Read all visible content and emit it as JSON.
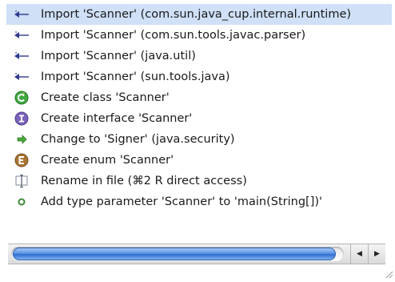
{
  "proposals": [
    {
      "label": "Import 'Scanner' (com.sun.java_cup.internal.runtime)",
      "icon": "import-arrow-icon",
      "selected": true
    },
    {
      "label": "Import 'Scanner' (com.sun.tools.javac.parser)",
      "icon": "import-arrow-icon"
    },
    {
      "label": "Import 'Scanner' (java.util)",
      "icon": "import-arrow-icon"
    },
    {
      "label": "Import 'Scanner' (sun.tools.java)",
      "icon": "import-arrow-icon"
    },
    {
      "label": "Create class 'Scanner'",
      "icon": "new-class-icon"
    },
    {
      "label": "Create interface 'Scanner'",
      "icon": "new-interface-icon"
    },
    {
      "label": "Change to 'Signer' (java.security)",
      "icon": "change-type-icon"
    },
    {
      "label": "Create enum 'Scanner'",
      "icon": "new-enum-icon"
    },
    {
      "label": "Rename in file (⌘2 R direct access)",
      "icon": "rename-icon"
    },
    {
      "label": "Add type parameter 'Scanner' to 'main(String[])'",
      "icon": "type-parameter-icon"
    }
  ],
  "scrollbar": {
    "left_arrow": "◀",
    "right_arrow": "▶",
    "thumb_fraction": 0.97
  },
  "colors": {
    "selection": "#cfe0f7",
    "class_icon": "#3fa93f",
    "interface_icon": "#7a63b8",
    "enum_icon": "#a87432"
  }
}
